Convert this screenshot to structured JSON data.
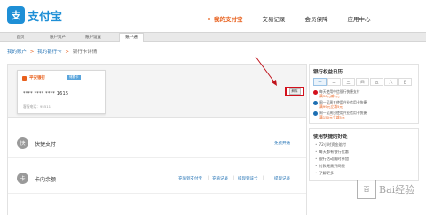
{
  "brand": {
    "logo_char": "支",
    "name": "支付宝"
  },
  "mainnav": {
    "items": [
      {
        "label": "我的支付宝",
        "active": true
      },
      {
        "label": "交易记录",
        "active": false
      },
      {
        "label": "会员保障",
        "active": false
      },
      {
        "label": "应用中心",
        "active": false
      }
    ]
  },
  "subnav": {
    "tabs": [
      "首页",
      "账户资产",
      "账户设置",
      "账户通"
    ]
  },
  "breadcrumb": {
    "level1": "我的账户",
    "level2": "我的银行卡",
    "current": "银行卡详情",
    "separator": ">"
  },
  "card": {
    "bank_name": "平安银行",
    "tag": "储蓄卡",
    "number": "**** **** **** 1615",
    "phone": "客服电话：95511",
    "unbind_label": "解除"
  },
  "features": {
    "quickpay": {
      "icon": "快",
      "title": "快捷支付",
      "link": "免费开通"
    },
    "balance": {
      "icon": "卡",
      "title": "卡内余额",
      "links": [
        "充值到支付宝",
        "充值记录",
        "提现到该卡",
        "提现记录"
      ]
    }
  },
  "sidebar": {
    "calendar_title": "银行权益日历",
    "weekdays": [
      "一",
      "二",
      "三",
      "四",
      "五",
      "六",
      "日"
    ],
    "promos": [
      {
        "icon": "bank-red",
        "text": "每天使用中信银行快捷支付",
        "text2": "满30元减5元"
      },
      {
        "icon": "bank-blue",
        "text": "周一至周五使用兴业信用卡快捷",
        "text2": "满99元立减5元"
      },
      {
        "icon": "bank-blue",
        "text": "周一至周日使用兴业信用卡快捷",
        "text2": "满150元立减5元"
      }
    ],
    "benefits_title": "使用快捷的好处",
    "benefits": [
      "72小时资金赔付",
      "每天都有银行优惠",
      "银行活动随时参加",
      "付款无需开网银",
      "了解更多"
    ]
  },
  "watermark": {
    "char": "百",
    "text": "Bai经验"
  },
  "colors": {
    "brand_blue": "#1e8fd6",
    "active_orange": "#e8601d",
    "highlight_red": "#d3101c"
  }
}
